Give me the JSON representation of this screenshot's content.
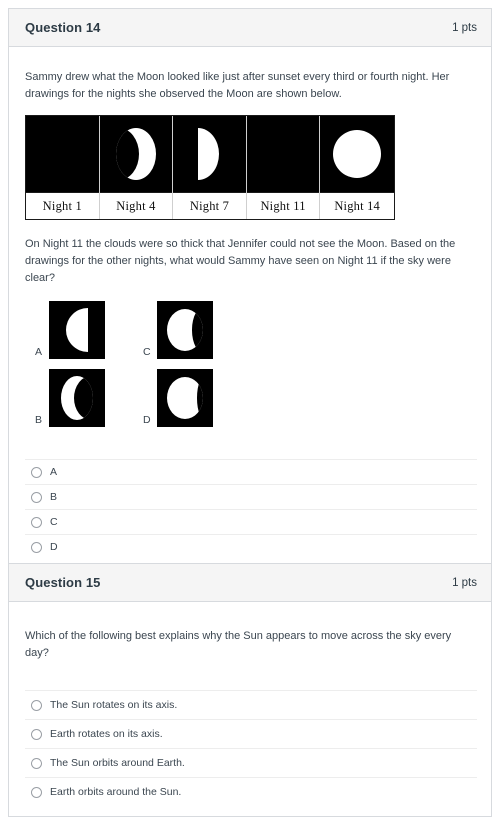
{
  "questions": [
    {
      "header": {
        "title": "Question 14",
        "points": "1 pts"
      },
      "prompt_1": "Sammy drew what the Moon looked like just after sunset every third or fourth night. Her drawings for the nights she observed the Moon are shown below.",
      "prompt_2": "On Night 11 the clouds were so thick that Jennifer could not see the Moon. Based on the drawings for the other nights, what would Sammy have seen on Night 11 if the sky were clear?",
      "night_strip": [
        {
          "label": "Night 1",
          "phase": "new"
        },
        {
          "label": "Night 4",
          "phase": "waxing-crescent"
        },
        {
          "label": "Night 7",
          "phase": "first-quarter"
        },
        {
          "label": "Night 11",
          "phase": "unknown"
        },
        {
          "label": "Night 14",
          "phase": "full"
        }
      ],
      "image_choices": [
        {
          "letter": "A",
          "phase": "half-left"
        },
        {
          "letter": "B",
          "phase": "crescent-left"
        },
        {
          "letter": "C",
          "phase": "gibbous-left"
        },
        {
          "letter": "D",
          "phase": "gibbous-left-fuller"
        }
      ],
      "answers": [
        "A",
        "B",
        "C",
        "D"
      ]
    },
    {
      "header": {
        "title": "Question 15",
        "points": "1 pts"
      },
      "prompt_1": "Which of the following best explains why the Sun appears to move across the sky every day?",
      "answers": [
        "The Sun rotates on its axis.",
        "Earth rotates on its axis.",
        "The Sun orbits around Earth.",
        "Earth orbits around the Sun."
      ]
    }
  ]
}
